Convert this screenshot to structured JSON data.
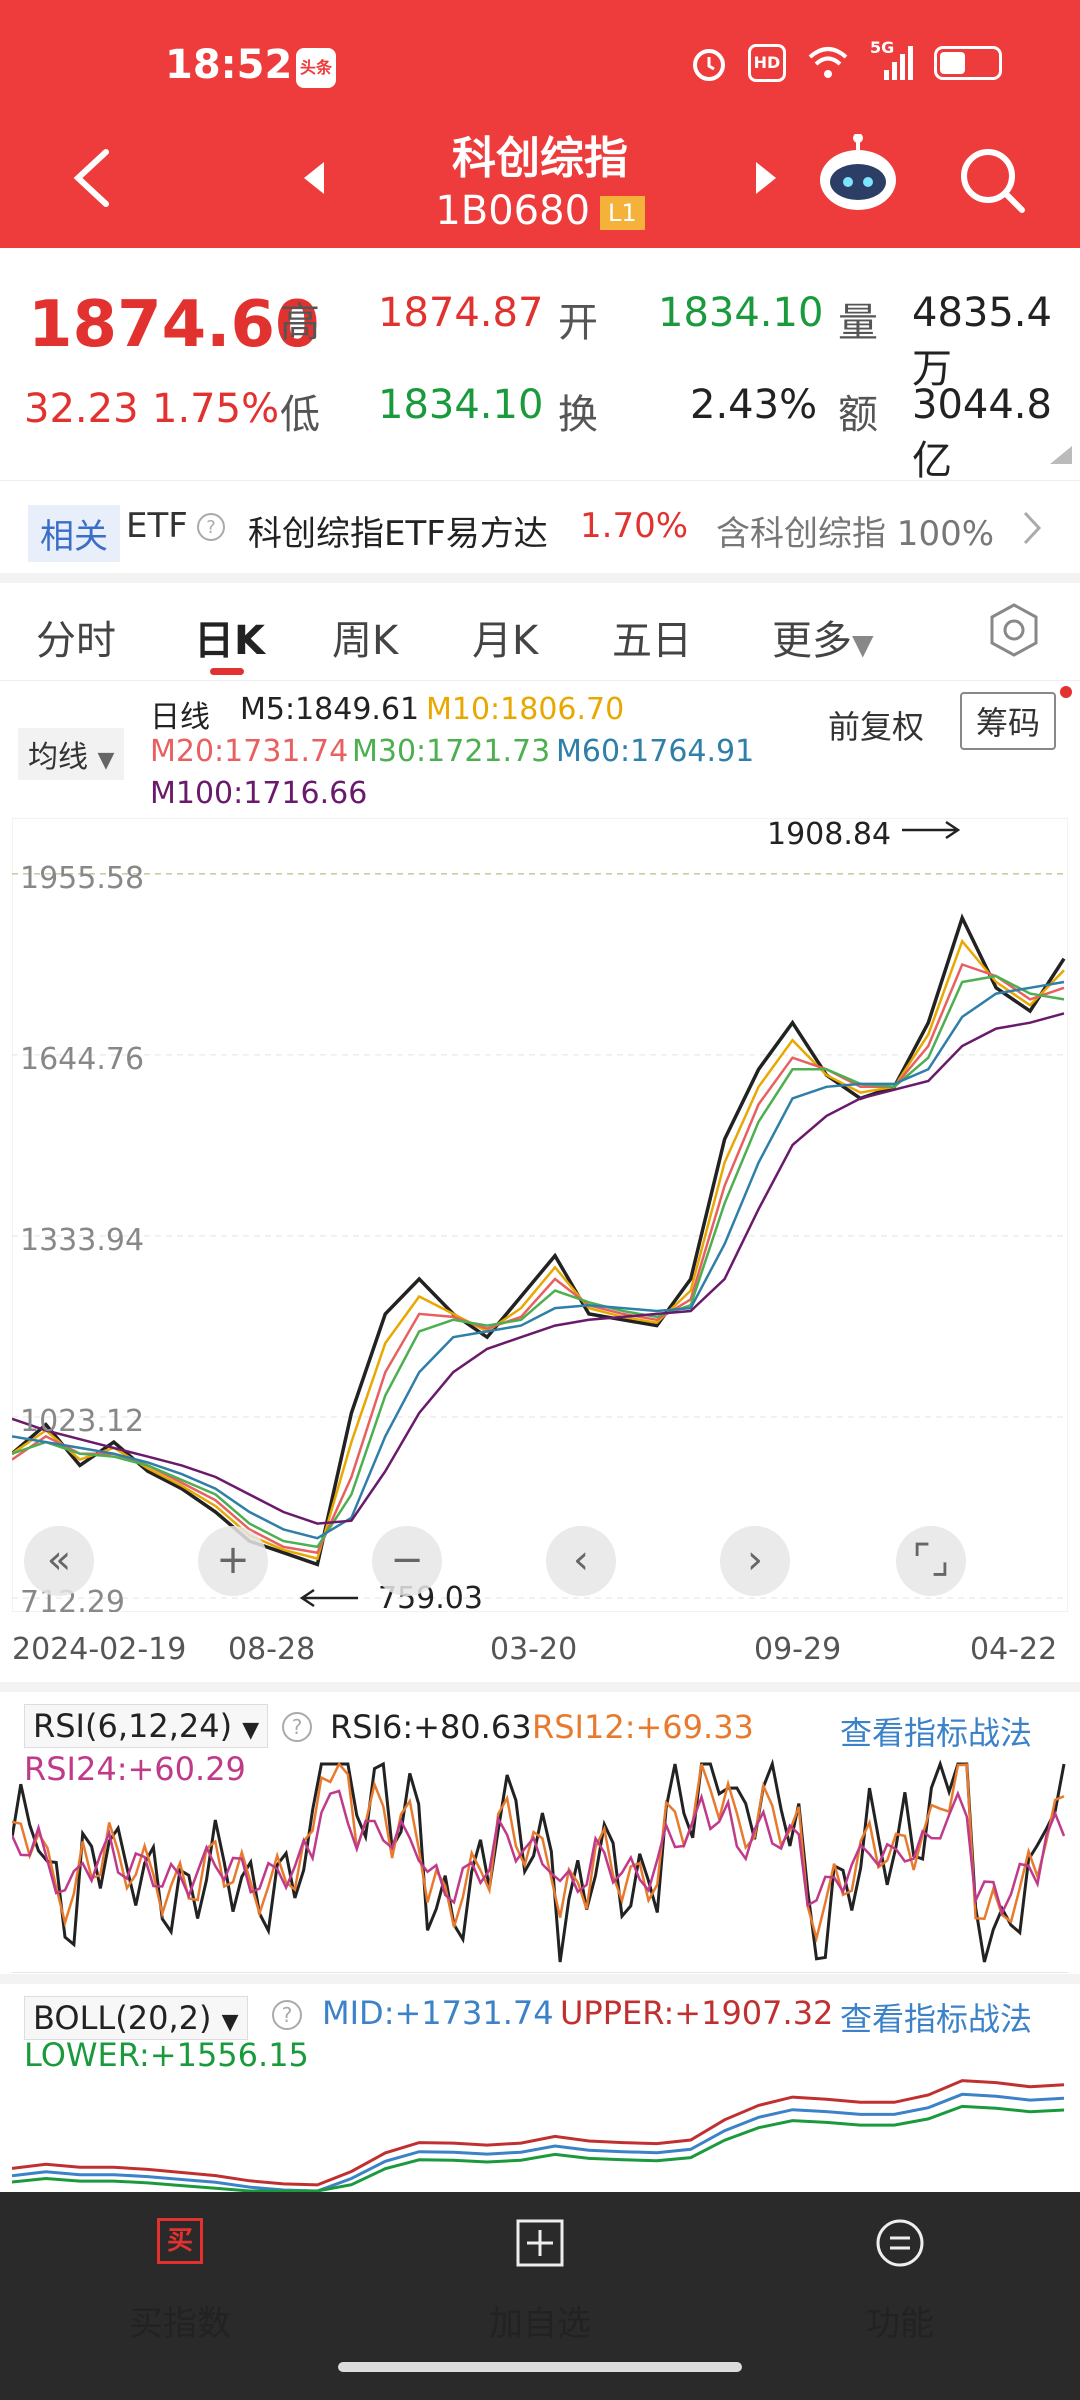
{
  "status_bar": {
    "time": "18:52",
    "news_badge": "头条",
    "hd": "HD",
    "network": "5G",
    "battery_level": 0.45
  },
  "header": {
    "title": "科创综指",
    "code": "1B0680",
    "level": "L1"
  },
  "quote": {
    "price": "1874.60",
    "change": "32.23",
    "change_pct": "1.75%",
    "high_label": "高",
    "high": "1874.87",
    "low_label": "低",
    "low": "1834.10",
    "open_label": "开",
    "open": "1834.10",
    "turnover_label": "换",
    "turnover": "2.43%",
    "volume_label": "量",
    "volume": "4835.4万",
    "amount_label": "额",
    "amount": "3044.8亿"
  },
  "etf": {
    "tag": "相关",
    "label": "ETF",
    "name": "科创综指ETF易方达",
    "change": "1.70%",
    "holding": "含科创综指 100%"
  },
  "tabs": [
    "分时",
    "日K",
    "周K",
    "月K",
    "五日",
    "更多"
  ],
  "ma": {
    "selector": "均线",
    "period": "日线",
    "m5": "M5:1849.61",
    "m10": "M10:1806.70",
    "m20": "M20:1731.74",
    "m30": "M30:1721.73",
    "m60": "M60:1764.91",
    "m100": "M100:1716.66",
    "adjust": "前复权",
    "chips": "筹码"
  },
  "chart_labels": {
    "y_ticks": [
      "1955.58",
      "1644.76",
      "1333.94",
      "1023.12",
      "712.29"
    ],
    "high_marker": "1908.84",
    "low_marker": "759.03",
    "x_ticks": [
      "2024-02-19",
      "08-28",
      "03-20",
      "09-29",
      "04-22"
    ]
  },
  "rsi": {
    "selector": "RSI(6,12,24)",
    "rsi6": "RSI6:+80.63",
    "rsi12": "RSI12:+69.33",
    "rsi24": "RSI24:+60.29",
    "link": "查看指标战法"
  },
  "boll": {
    "selector": "BOLL(20,2)",
    "mid": "MID:+1731.74",
    "upper": "UPPER:+1907.32",
    "lower": "LOWER:+1556.15",
    "link": "查看指标战法"
  },
  "bottom_nav": {
    "buy_icon": "买",
    "buy": "买指数",
    "add": "加自选",
    "func": "功能"
  },
  "colors": {
    "header": "#ee3b3b",
    "up": "#e2322f",
    "down": "#1a9a3c",
    "link": "#3b82c8"
  },
  "chart_data": {
    "type": "line",
    "title": "",
    "x_ticks": [
      "2024-02-19",
      "08-28",
      "03-20",
      "09-29",
      "04-22"
    ],
    "y_ticks": [
      1955.58,
      1644.76,
      1333.94,
      1023.12,
      712.29
    ],
    "ylim": [
      712.29,
      2000
    ],
    "series": [
      {
        "name": "M5",
        "color": "#222222",
        "values": [
          960,
          1010,
          940,
          980,
          930,
          900,
          860,
          810,
          790,
          770,
          1030,
          1200,
          1260,
          1200,
          1160,
          1230,
          1300,
          1200,
          1190,
          1180,
          1260,
          1500,
          1620,
          1700,
          1610,
          1570,
          1590,
          1700,
          1880,
          1760,
          1720,
          1810
        ]
      },
      {
        "name": "M10",
        "color": "#e8a800",
        "values": [
          960,
          1000,
          950,
          970,
          935,
          905,
          870,
          820,
          795,
          780,
          980,
          1150,
          1230,
          1200,
          1170,
          1210,
          1280,
          1210,
          1195,
          1185,
          1240,
          1460,
          1590,
          1670,
          1610,
          1580,
          1590,
          1680,
          1840,
          1770,
          1730,
          1790
        ]
      },
      {
        "name": "M20",
        "color": "#e86060",
        "values": [
          950,
          990,
          960,
          960,
          940,
          910,
          880,
          830,
          800,
          790,
          920,
          1100,
          1200,
          1195,
          1175,
          1195,
          1260,
          1215,
          1200,
          1190,
          1225,
          1420,
          1560,
          1640,
          1620,
          1590,
          1590,
          1660,
          1800,
          1780,
          1740,
          1760
        ]
      },
      {
        "name": "M30",
        "color": "#4caf50",
        "values": [
          960,
          980,
          960,
          955,
          940,
          915,
          890,
          840,
          810,
          800,
          890,
          1060,
          1170,
          1190,
          1180,
          1190,
          1240,
          1220,
          1205,
          1195,
          1215,
          1390,
          1530,
          1620,
          1620,
          1595,
          1590,
          1640,
          1770,
          1780,
          1750,
          1740
        ]
      },
      {
        "name": "M60",
        "color": "#2f7fa8",
        "values": [
          990,
          980,
          970,
          960,
          945,
          925,
          900,
          860,
          830,
          815,
          850,
          990,
          1100,
          1160,
          1170,
          1180,
          1210,
          1215,
          1210,
          1205,
          1210,
          1320,
          1460,
          1570,
          1590,
          1595,
          1595,
          1620,
          1710,
          1750,
          1760,
          1770
        ]
      },
      {
        "name": "M100",
        "color": "#6a1a6a",
        "values": [
          1020,
          1000,
          985,
          970,
          955,
          940,
          920,
          890,
          860,
          840,
          845,
          930,
          1030,
          1100,
          1140,
          1160,
          1180,
          1190,
          1195,
          1200,
          1205,
          1260,
          1380,
          1490,
          1540,
          1570,
          1585,
          1600,
          1660,
          1690,
          1700,
          1716
        ]
      }
    ]
  }
}
